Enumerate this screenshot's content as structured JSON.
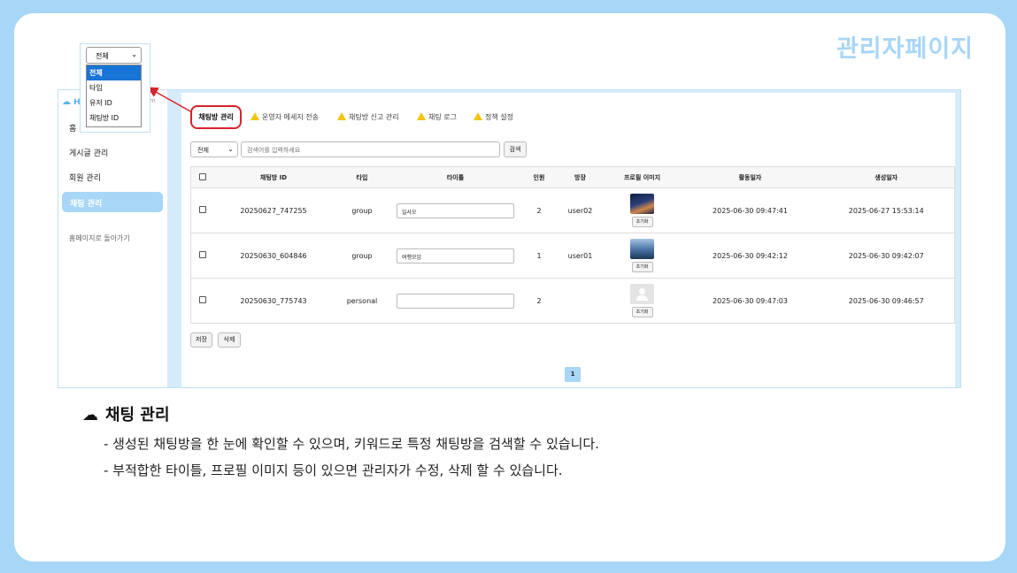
{
  "slide_title": "관리자페이지",
  "sidebar": {
    "logo": "H",
    "logo_right": "m",
    "items": [
      "홈",
      "게시글 관리",
      "회원 관리",
      "채팅 관리"
    ],
    "back_link": "홈페이지로 돌아가기",
    "active": "채팅 관리"
  },
  "tabs": {
    "active": "채팅방 관리",
    "others": [
      "운영자 메세지 전송",
      "채팅방 신고 관리",
      "채팅 로그",
      "정책 설정"
    ]
  },
  "search": {
    "select_value": "전체",
    "placeholder": "검색어를 입력하세요",
    "button": "검색"
  },
  "table": {
    "headers": [
      "채팅방 ID",
      "타입",
      "타이틀",
      "인원",
      "방장",
      "프로필 이미지",
      "활동일자",
      "생성일자"
    ],
    "rows": [
      {
        "id": "20250627_747255",
        "type": "group",
        "title": "일사오",
        "members": "2",
        "owner": "user02",
        "image": "night",
        "reset": "초기화",
        "active_at": "2025-06-30 09:47:41",
        "created_at": "2025-06-27 15:53:14"
      },
      {
        "id": "20250630_604846",
        "type": "group",
        "title": "여행모임",
        "members": "1",
        "owner": "user01",
        "image": "sky",
        "reset": "초기화",
        "active_at": "2025-06-30 09:42:12",
        "created_at": "2025-06-30 09:42:07"
      },
      {
        "id": "20250630_775743",
        "type": "personal",
        "title": "",
        "members": "2",
        "owner": "",
        "image": "empty",
        "reset": "초기화",
        "active_at": "2025-06-30 09:47:03",
        "created_at": "2025-06-30 09:46:57"
      }
    ]
  },
  "actions": {
    "save": "저장",
    "delete": "삭제"
  },
  "pagination": {
    "current": "1"
  },
  "dropdown": {
    "value": "전체",
    "options": [
      "전체",
      "타입",
      "유저 ID",
      "채팅방 ID"
    ],
    "selected": "전체"
  },
  "description": {
    "title": "채팅 관리",
    "lines": [
      "- 생성된 채팅방을 한 눈에 확인할 수 있으며, 키워드로 특정 채팅방을 검색할 수 있습니다.",
      "- 부적합한 타이틀, 프로필 이미지 등이 있으면 관리자가 수정, 삭제 할 수 있습니다."
    ]
  },
  "colors": {
    "background": "#a7d6f7",
    "highlight": "#d6242a",
    "accent": "#1874d6"
  }
}
